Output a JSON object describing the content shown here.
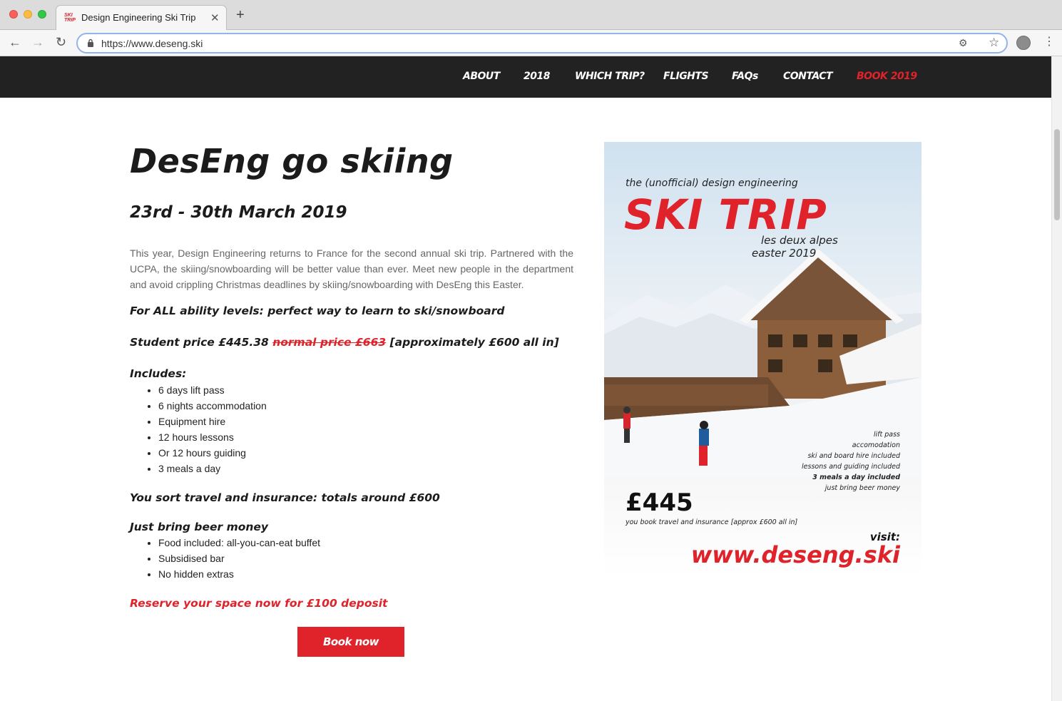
{
  "browser": {
    "tab_title": "Design Engineering Ski Trip",
    "favicon_text_1": "SKI",
    "favicon_text_2": "TRIP",
    "tab_close": "✕",
    "new_tab": "+",
    "url": "https://www.deseng.ski"
  },
  "nav": {
    "items": [
      "ABOUT",
      "2018",
      "WHICH TRIP?",
      "FLIGHTS",
      "FAQs",
      "CONTACT",
      "BOOK 2019"
    ],
    "accent_color": "#e0222a"
  },
  "main": {
    "title": "DesEng go skiing",
    "dates": "23rd - 30th March 2019",
    "intro": "This year, Design Engineering returns to France for the second annual ski trip. Partnered with the UCPA, the skiing/snowboarding will be better value than ever. Meet new people in the department and avoid crippling Christmas deadlines by skiing/snowboarding with DesEng this Easter.",
    "ability": "For ALL ability levels: perfect way to learn to ski/snowboard",
    "price_prefix": "Student price £445.38",
    "price_normal": "normal price £663",
    "price_suffix": "[approximately £600 all in]",
    "includes_heading": "Includes:",
    "includes": [
      "6 days lift pass",
      "6 nights accommodation",
      "Equipment hire",
      "12 hours lessons",
      "Or 12 hours guiding",
      "3 meals a day"
    ],
    "travel": "You sort travel and insurance: totals around £600",
    "beer_heading": "Just bring beer money",
    "beer_items": [
      "Food included: all-you-can-eat buffet",
      "Subsidised bar",
      "No hidden extras"
    ],
    "reserve": "Reserve your space now for £100 deposit",
    "book_button": "Book now"
  },
  "poster": {
    "unofficial": "the (unofficial) design engineering",
    "title": "SKI TRIP",
    "location": "les deux alpes",
    "season": "easter 2019",
    "features": [
      "lift pass",
      "accomodation",
      "ski and board hire included",
      "lessons and guiding included",
      "3 meals a day included",
      "just bring beer money"
    ],
    "price": "£445",
    "travel_note": "you book travel and insurance [approx £600 all in]",
    "visit": "visit:",
    "url": "www.deseng.ski"
  }
}
